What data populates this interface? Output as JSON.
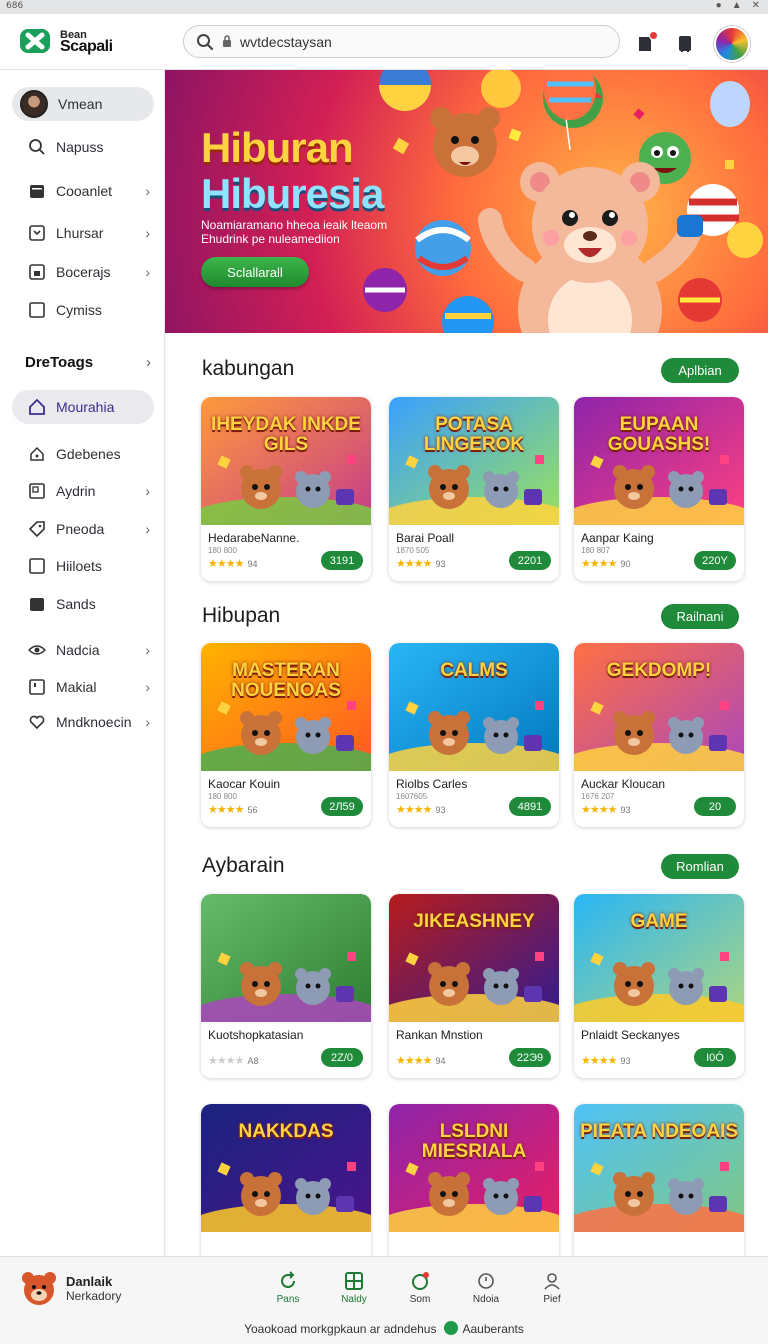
{
  "status_bar": {
    "time": "686",
    "icons": [
      "bell-icon",
      "wifi-icon",
      "close-icon"
    ]
  },
  "header": {
    "logo_line1": "Bean",
    "logo_line2": "Scapali",
    "search_value": "wvtdecstaysan"
  },
  "sidebar": {
    "profile_name": "Vmean",
    "items_top": [
      {
        "label": "Napuss",
        "icon": "search-icon",
        "chevron": false
      },
      {
        "label": "Cooanlet",
        "icon": "calendar-icon",
        "chevron": true
      },
      {
        "label": "Lhursar",
        "icon": "chevron-box-icon",
        "chevron": true
      },
      {
        "label": "Bocerajs",
        "icon": "tray-icon",
        "chevron": true
      },
      {
        "label": "Cymiss",
        "icon": "square-icon",
        "chevron": false
      }
    ],
    "section_heading": "DreToags",
    "active_item": "Mourahia",
    "items_bottom": [
      {
        "label": "Gdebenes",
        "icon": "home-outline-icon",
        "chevron": false
      },
      {
        "label": "Aydrin",
        "icon": "image-icon",
        "chevron": true
      },
      {
        "label": "Pneoda",
        "icon": "tag-icon",
        "chevron": true
      },
      {
        "label": "Hiiloets",
        "icon": "square-icon",
        "chevron": false
      },
      {
        "label": "Sands",
        "icon": "folder-icon",
        "chevron": false
      },
      {
        "label": "Nadcia",
        "icon": "eye-icon",
        "chevron": true
      },
      {
        "label": "Makial",
        "icon": "frame-icon",
        "chevron": true
      },
      {
        "label": "Mndknoecin",
        "icon": "heart-icon",
        "chevron": true
      }
    ]
  },
  "hero": {
    "title_line1": "Hiburan",
    "title_line2": "Hiburesia",
    "subtitle": "Noamiaramano hheoa ieaik lteaom Ehudrink pe nuleamediion",
    "cta_label": "Sclallarall"
  },
  "sections": [
    {
      "title": "kabungan",
      "action": "Aplbian",
      "cards": [
        {
          "thumb_title": "IHEYDAK INKDE GILS",
          "name": "HedarabeNanne.",
          "sub": "180 800",
          "stars": 4,
          "count": "94",
          "price": "3191"
        },
        {
          "thumb_title": "POTASA LINGEROK",
          "name": "Barai Poall",
          "sub": "1870 505",
          "stars": 4,
          "count": "93",
          "price": "2201"
        },
        {
          "thumb_title": "EUPAAN GOUASHS!",
          "name": "Aanpar Kaing",
          "sub": "180 807",
          "stars": 4,
          "count": "90",
          "price": "220Y"
        }
      ]
    },
    {
      "title": "Hibupan",
      "action": "Railnani",
      "cards": [
        {
          "thumb_title": "MASTERAN NOUENOAS",
          "name": "Kaocar Kouin",
          "sub": "180 800",
          "stars": 4,
          "count": "56",
          "price": "2Л59"
        },
        {
          "thumb_title": "CALMS",
          "name": "Riolbs Carles",
          "sub": "1607605",
          "stars": 4,
          "count": "93",
          "price": "4891"
        },
        {
          "thumb_title": "GEKDOMP!",
          "name": "Auckar Kloucan",
          "sub": "1676 207",
          "stars": 4,
          "count": "93",
          "price": "20"
        }
      ]
    },
    {
      "title": "Aybarain",
      "action": "Romlian",
      "cards": [
        {
          "thumb_title": "",
          "name": "Kuotshopkatasian",
          "sub": "",
          "stars": 0,
          "count": "A8",
          "price": "2Z/0"
        },
        {
          "thumb_title": "JIKEASHNEY",
          "name": "Rankan Mnstion",
          "sub": "",
          "stars": 4,
          "count": "94",
          "price": "22Э9"
        },
        {
          "thumb_title": "GAME",
          "name": "Pnlaidt Seckanyes",
          "sub": "",
          "stars": 4,
          "count": "93",
          "price": "I0Ó"
        }
      ]
    },
    {
      "title": "",
      "action": "",
      "cards": [
        {
          "thumb_title": "NAKKDAS",
          "name": "",
          "sub": "",
          "stars": 0,
          "count": "",
          "price": ""
        },
        {
          "thumb_title": "LSLDNI MIESRIALA",
          "name": "",
          "sub": "",
          "stars": 0,
          "count": "",
          "price": ""
        },
        {
          "thumb_title": "PIEATA NDEOAIS",
          "name": "",
          "sub": "",
          "stars": 0,
          "count": "",
          "price": ""
        }
      ]
    }
  ],
  "bottom_bar": {
    "brand_line1": "Danlaik",
    "brand_line2": "Nerkadory",
    "tabs": [
      {
        "label": "Pans",
        "icon": "refresh-icon"
      },
      {
        "label": "Naldy",
        "icon": "grid-icon"
      },
      {
        "label": "Som",
        "icon": "notification-icon"
      },
      {
        "label": "Ndoia",
        "icon": "clock-icon"
      },
      {
        "label": "Pief",
        "icon": "profile-icon"
      }
    ],
    "footer_text": "Yoaokoad morkgpkaun ar adndehus",
    "footer_link": "Aauberants"
  },
  "colors": {
    "accent_green": "#1f8a3a",
    "hero_red": "#d21f55",
    "star": "#f4b400"
  }
}
